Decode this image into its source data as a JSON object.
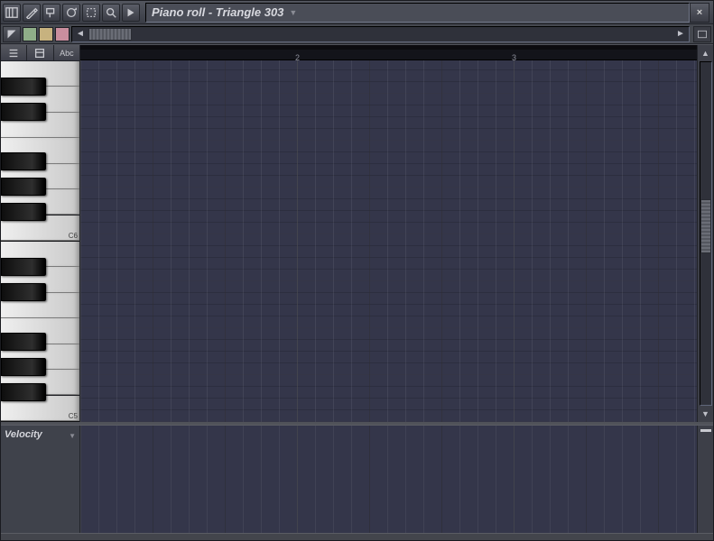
{
  "window": {
    "title": "Piano roll - Triangle 303",
    "close_glyph": "×"
  },
  "titlebar_tools": [
    {
      "name": "piano-roll-icon"
    },
    {
      "name": "draw-tool-icon"
    },
    {
      "name": "paint-tool-icon"
    },
    {
      "name": "cycle-icon"
    },
    {
      "name": "select-tool-icon"
    },
    {
      "name": "zoom-tool-icon"
    },
    {
      "name": "playback-tool-icon"
    }
  ],
  "colors": {
    "chip1": "#8fae88",
    "chip2": "#c7b27f",
    "chip3": "#c98e9e"
  },
  "left_tools": {
    "btn1_label": "",
    "btn2_label": "",
    "btn3_label": "Abc"
  },
  "ruler": {
    "bar2": "2",
    "bar3": "3"
  },
  "octaves": {
    "o1": "C6",
    "o2": "C5"
  },
  "velocity": {
    "label": "Velocity"
  }
}
